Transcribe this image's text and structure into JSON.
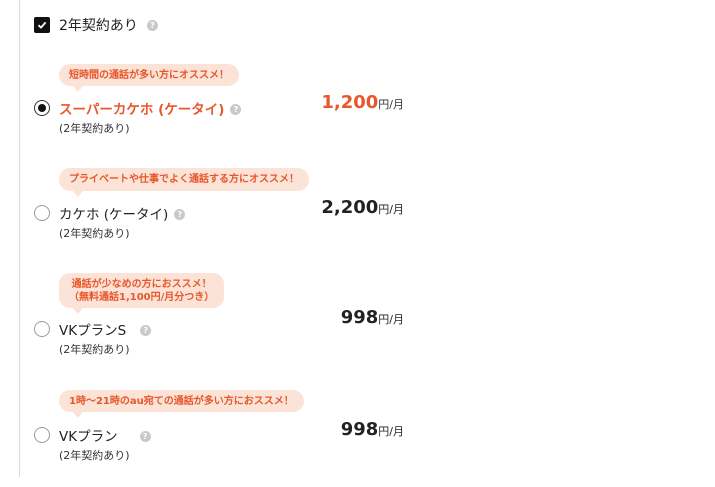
{
  "contract": {
    "label": "2年契約あり",
    "checked": true
  },
  "plans": [
    {
      "bubble": [
        "短時間の通話が多い方にオススメ！"
      ],
      "name": "スーパーカケホ (ケータイ)",
      "sub": "(2年契約あり)",
      "price": "1,200",
      "unit": "円/月",
      "selected": true
    },
    {
      "bubble": [
        "プライベートや仕事でよく通話する方にオススメ！"
      ],
      "name": "カケホ (ケータイ)",
      "sub": "(2年契約あり)",
      "price": "2,200",
      "unit": "円/月",
      "selected": false
    },
    {
      "bubble": [
        "通話が少なめの方におススメ！",
        "（無料通話1,100円/月分つき）"
      ],
      "name": "VKプランS",
      "sub": "(2年契約あり)",
      "price": "998",
      "unit": "円/月",
      "selected": false
    },
    {
      "bubble": [
        "1時〜21時のau宛ての通話が多い方におススメ！"
      ],
      "name": "VKプラン",
      "sub": "(2年契約あり)",
      "price": "998",
      "unit": "円/月",
      "selected": false
    }
  ],
  "colors": {
    "accent": "#e8572a",
    "bubble_bg": "#fbe3d7",
    "help_icon": "#c9c9c9"
  },
  "icons": {
    "help": "question-circle-icon",
    "check": "checkmark-icon"
  }
}
